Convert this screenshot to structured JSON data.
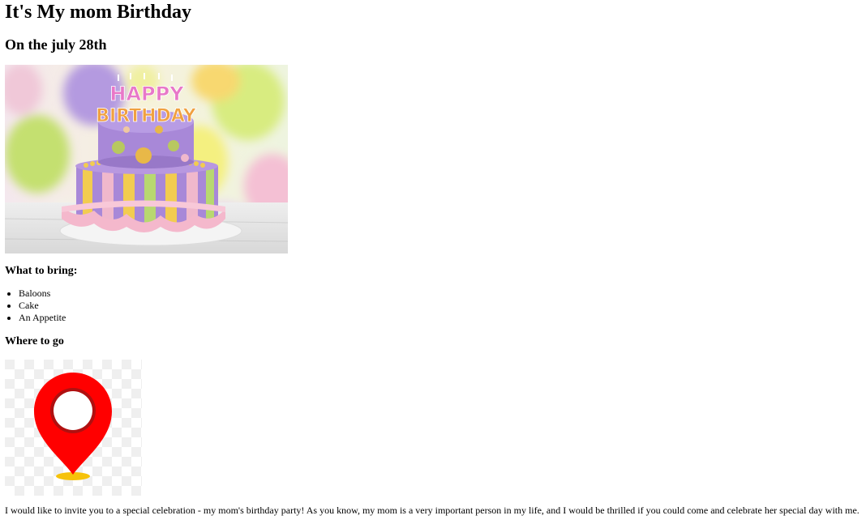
{
  "page": {
    "title": "It's My mom Birthday",
    "date_heading": "On the july 28th",
    "cake_image": {
      "topper_text_line1": "HAPPY",
      "topper_text_line2": "BIRTHDAY",
      "colors": {
        "balloon_purple": "#b49ae0",
        "balloon_yellow": "#f0f070",
        "balloon_green": "#b8e070",
        "balloon_pink": "#f4b8d0",
        "cake_purple": "#a888d8",
        "cake_pink": "#f4b8cc",
        "stripe_yellow": "#f2cc50",
        "stripe_green": "#b8d870",
        "dot_orange": "#e8b848",
        "dot_green": "#b8c860",
        "plate": "#f2f2f2",
        "table": "#e4e4e4"
      }
    },
    "bring_heading": "What to bring:",
    "bring_items": [
      "Baloons",
      "Cake",
      "An Appetite"
    ],
    "where_heading": "Where to go",
    "map_pin": {
      "icon": "map-pin-icon",
      "pin_color": "#ff0000",
      "pin_outline": "#b01010",
      "base_color": "#f6c20a",
      "checker_color": "#efefef"
    },
    "invitation_text": "I would like to invite you to a special celebration - my mom's birthday party! As you know, my mom is a very important person in my life, and I would be thrilled if you could come and celebrate her special day with me."
  }
}
